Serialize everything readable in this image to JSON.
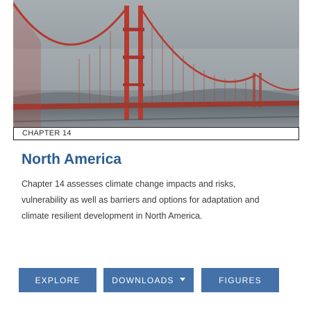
{
  "hero": {
    "image_subject": "golden-gate-bridge-photo"
  },
  "chapter": {
    "label": "CHAPTER 14"
  },
  "title": "North America",
  "description": "Chapter 14 assesses climate change impacts and risks, vulnerability as well as barriers and options for adaptation and climate resilient development in North America.",
  "buttons": {
    "explore": "EXPLORE",
    "downloads": "DOWNLOADS",
    "figures": "FIGURES"
  },
  "colors": {
    "accent": "#4472a8",
    "title": "#2b5c93",
    "bridge": "#c0392b"
  }
}
